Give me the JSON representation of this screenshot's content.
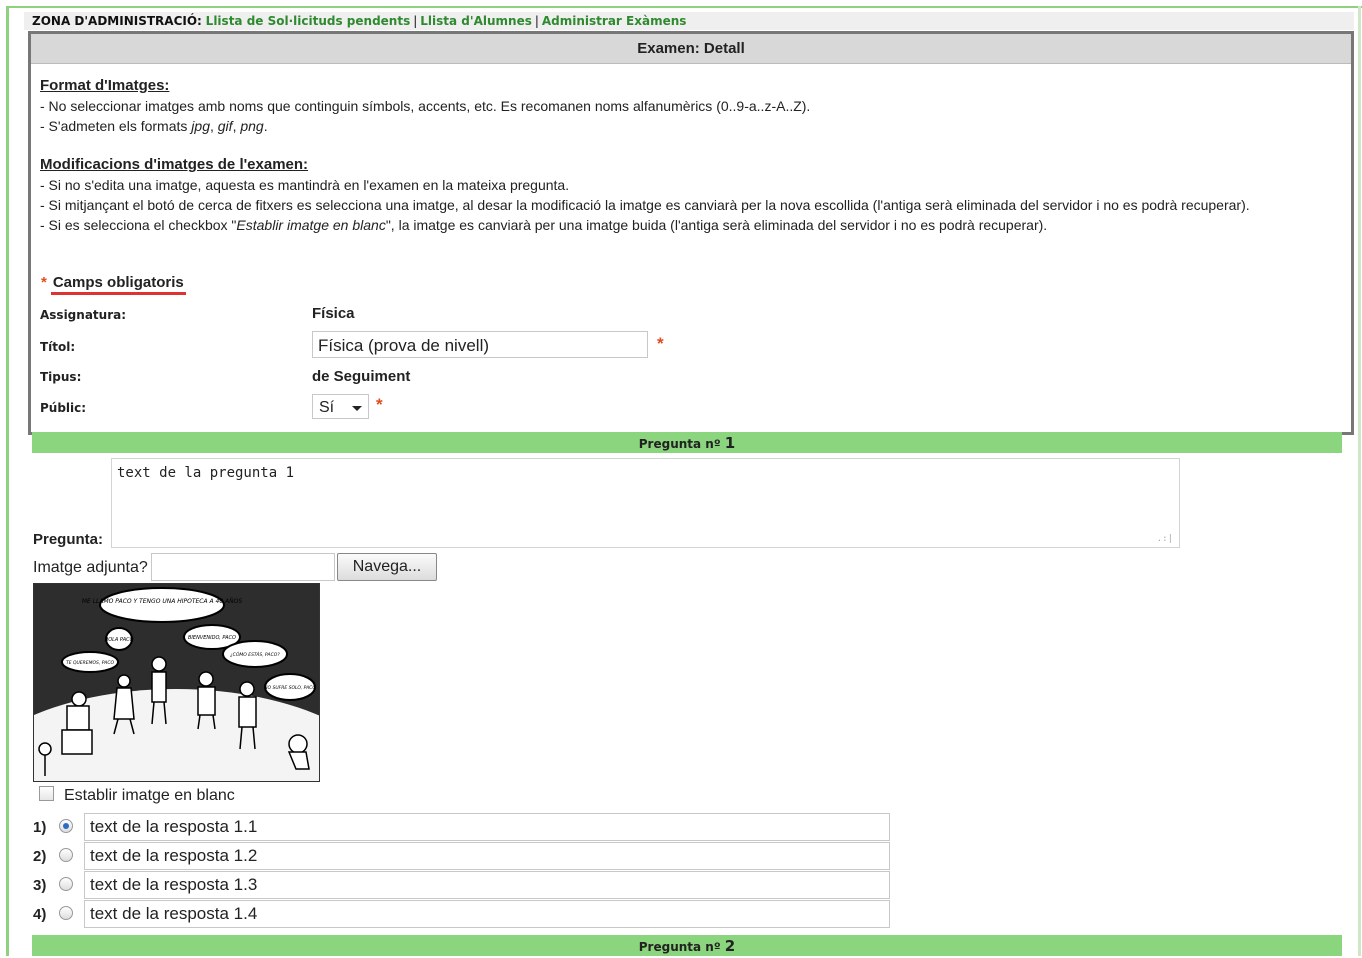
{
  "admin_nav": {
    "title": "ZONA D'ADMINISTRACIÓ:",
    "links": [
      "Llista de Sol·licituds pendents",
      "Llista d'Alumnes",
      "Administrar Exàmens"
    ],
    "link_color": "#2f8a2f"
  },
  "panel": {
    "header": "Examen: Detall",
    "format_heading": "Format d'Imatges:",
    "format_lines": [
      "- No seleccionar imatges amb noms que continguin símbols, accents, etc. Es recomanen noms alfanumèrics (0..9-a..z-A..Z).",
      "- S'admeten els formats "
    ],
    "format_types": [
      "jpg",
      "gif",
      "png"
    ],
    "mod_heading": "Modificacions d'imatges de l'examen:",
    "mod_lines": [
      "- Si no s'edita una imatge, aquesta es mantindrà en l'examen en la mateixa pregunta.",
      "- Si mitjançant el botó de cerca de fitxers es selecciona una imatge, al desar la modificació la imatge es canviarà per la nova escollida (l'antiga serà eliminada del servidor i no es podrà recuperar).",
      "- Si es selecciona el checkbox \"",
      "Establir imatge en blanc",
      "\", la imatge es canviarà per una imatge buida (l'antiga serà eliminada del servidor i no es podrà recuperar)."
    ]
  },
  "form": {
    "required_star": "*",
    "required_label": "Camps obligatoris",
    "subject_label": "Assignatura:",
    "subject_value": "Física",
    "title_label": "Títol:",
    "title_value": "Física (prova de nivell)",
    "type_label": "Tipus:",
    "type_value": "de Seguiment",
    "public_label": "Públic:",
    "public_value": "Sí"
  },
  "questions": [
    {
      "bar_label": "Pregunta nº",
      "number": "1",
      "question_label": "Pregunta:",
      "question_text": "text de la pregunta 1",
      "image_label": "Imatge adjunta?",
      "browse_label": "Navega...",
      "blank_image_label": "Establir imatge en blanc",
      "answers": [
        {
          "num": "1)",
          "text": "text de la resposta 1.1",
          "selected": true
        },
        {
          "num": "2)",
          "text": "text de la resposta 1.2",
          "selected": false
        },
        {
          "num": "3)",
          "text": "text de la resposta 1.3",
          "selected": false
        },
        {
          "num": "4)",
          "text": "text de la resposta 1.4",
          "selected": false
        }
      ]
    },
    {
      "bar_label": "Pregunta nº",
      "number": "2"
    }
  ],
  "comic_text": [
    "ME LLAMO PACO Y TENGO UNA HIPOTECA A 40 AÑOS",
    "HOLA PACO",
    "BIENVENIDO, PACO",
    "TE QUEREMOS, PACO",
    "¿CÓMO ESTÁS, PACO?",
    "NO SUFRE SOLO, PACO"
  ],
  "colors": {
    "green_bar": "#8ad57d",
    "required": "#e04b20",
    "panel_border": "#777777"
  }
}
